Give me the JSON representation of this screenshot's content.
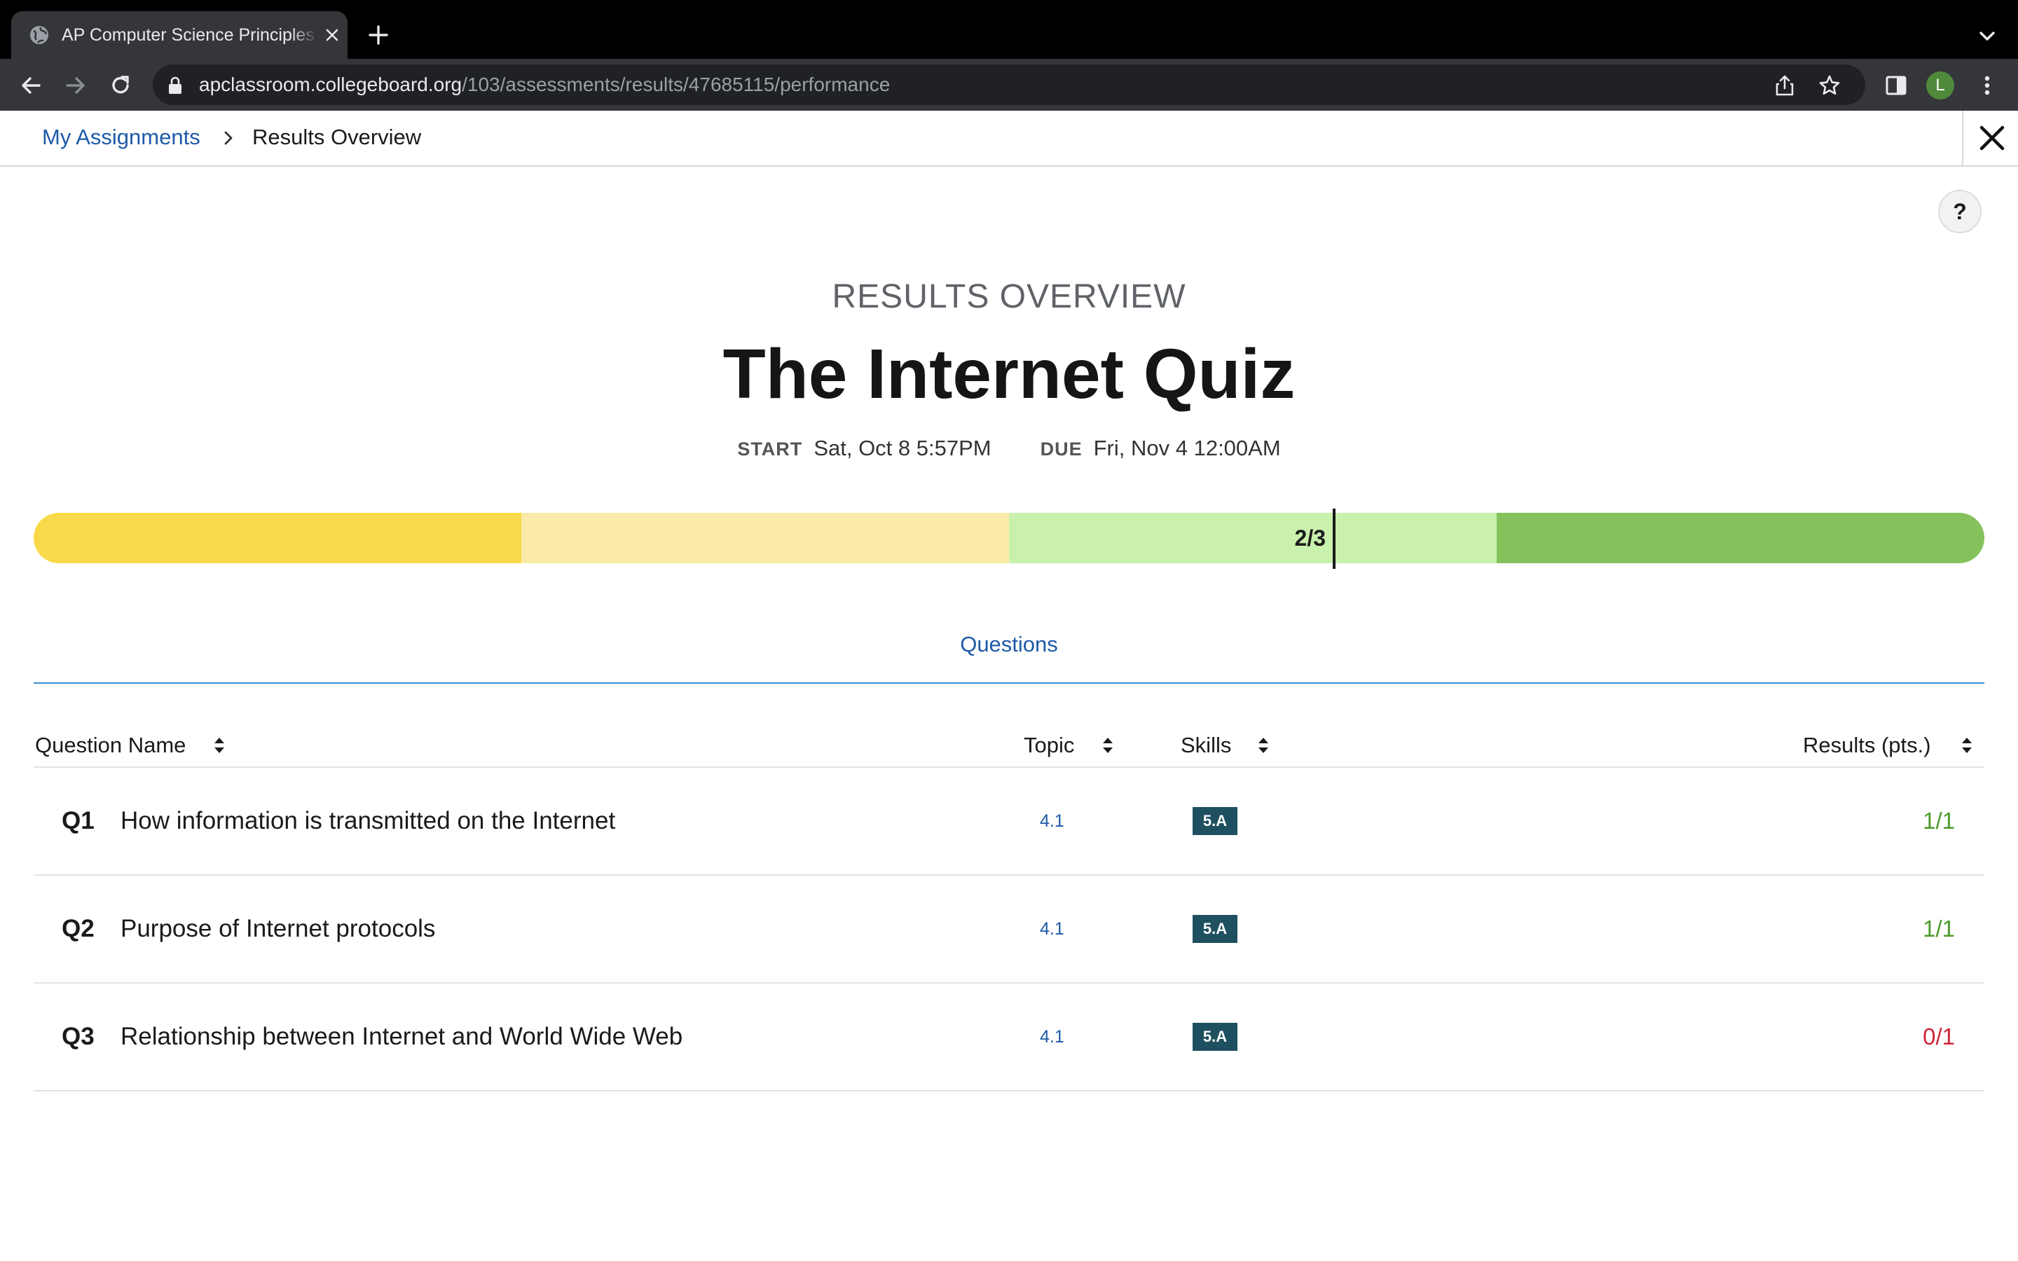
{
  "browser": {
    "tab_title": "AP Computer Science Principles",
    "url_host": "apclassroom.collegeboard.org",
    "url_path": "/103/assessments/results/47685115/performance",
    "profile_initial": "L"
  },
  "breadcrumb": {
    "link": "My Assignments",
    "current": "Results Overview"
  },
  "header": {
    "eyebrow": "RESULTS OVERVIEW",
    "title": "The Internet Quiz",
    "start_label": "START",
    "start_value": "Sat, Oct 8 5:57PM",
    "due_label": "DUE",
    "due_value": "Fri, Nov 4 12:00AM",
    "help_label": "?"
  },
  "score": {
    "label": "2/3",
    "earned": 2,
    "possible": 3,
    "colors": [
      "#f9d94a",
      "#fbeba8",
      "#c9f1ad",
      "#85c25c"
    ]
  },
  "tabs": {
    "questions": "Questions"
  },
  "table": {
    "columns": {
      "question_name": "Question Name",
      "topic": "Topic",
      "skills": "Skills",
      "results": "Results (pts.)"
    },
    "rows": [
      {
        "num": "Q1",
        "name": "How information is transmitted on the Internet",
        "topic": "4.1",
        "skill": "5.A",
        "result": "1/1",
        "result_color": "#4c9a2a"
      },
      {
        "num": "Q2",
        "name": "Purpose of Internet protocols",
        "topic": "4.1",
        "skill": "5.A",
        "result": "1/1",
        "result_color": "#4c9a2a"
      },
      {
        "num": "Q3",
        "name": "Relationship between Internet and World Wide Web",
        "topic": "4.1",
        "skill": "5.A",
        "result": "0/1",
        "result_color": "#d0243a"
      }
    ]
  }
}
